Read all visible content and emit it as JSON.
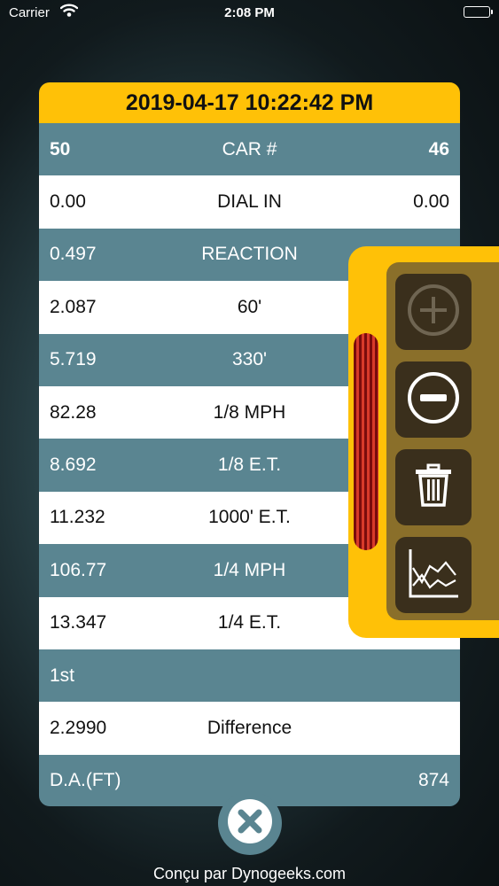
{
  "status_bar": {
    "carrier": "Carrier",
    "time": "2:08 PM"
  },
  "card": {
    "timestamp": "2019-04-17 10:22:42 PM",
    "rows": [
      {
        "left": "50",
        "label": "CAR #",
        "right": "46"
      },
      {
        "left": "0.00",
        "label": "DIAL IN",
        "right": "0.00"
      },
      {
        "left": "0.497",
        "label": "REACTION",
        "right": ""
      },
      {
        "left": "2.087",
        "label": "60'",
        "right": ""
      },
      {
        "left": "5.719",
        "label": "330'",
        "right": ""
      },
      {
        "left": "82.28",
        "label": "1/8 MPH",
        "right": ""
      },
      {
        "left": "8.692",
        "label": "1/8 E.T.",
        "right": ""
      },
      {
        "left": "11.232",
        "label": "1000' E.T.",
        "right": ""
      },
      {
        "left": "106.77",
        "label": "1/4 MPH",
        "right": ""
      },
      {
        "left": "13.347",
        "label": "1/4 E.T.",
        "right": ""
      },
      {
        "left": "1st",
        "label": "",
        "right": ""
      },
      {
        "left": "2.2990",
        "label": "Difference",
        "right": ""
      },
      {
        "left": "D.A.(FT)",
        "label": "",
        "right": "874"
      }
    ]
  },
  "tools": {
    "add_icon": "plus-circle-icon",
    "remove_icon": "minus-circle-icon",
    "delete_icon": "trash-icon",
    "chart_icon": "line-chart-icon"
  },
  "footer": {
    "credit": "Conçu par Dynogeeks.com"
  },
  "colors": {
    "accent": "#ffc107",
    "row_dark": "#5a8591",
    "row_light": "#ffffff",
    "panel_inner": "#8a6f2a",
    "button_bg": "#3a2f1c"
  }
}
